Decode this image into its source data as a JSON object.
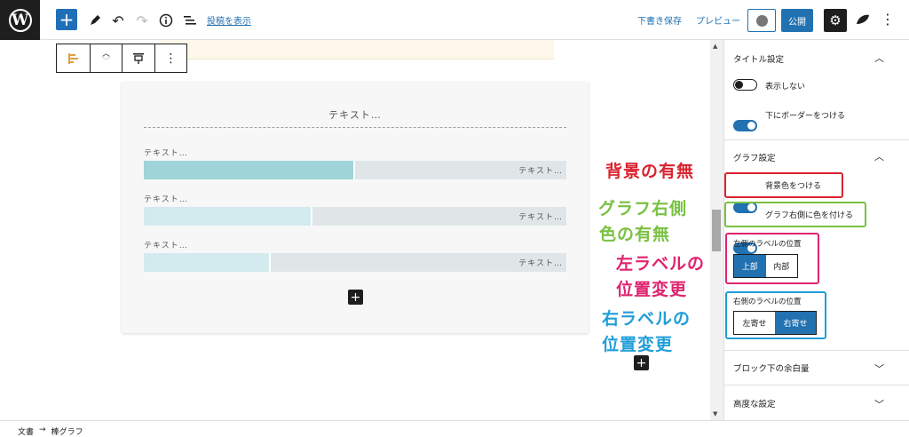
{
  "topbar": {
    "show_post_link": "投稿を表示",
    "save_draft": "下書き保存",
    "preview": "プレビュー",
    "publish": "公開"
  },
  "graph": {
    "title": "テキスト…",
    "rows": [
      {
        "left_label": "テキスト…",
        "right_label": "テキスト…",
        "fill_ratio": 0.5
      },
      {
        "left_label": "テキスト…",
        "right_label": "テキスト…",
        "fill_ratio": 0.4
      },
      {
        "left_label": "テキスト…",
        "right_label": "テキスト…",
        "fill_ratio": 0.3
      }
    ],
    "colors": [
      "#9fd4d9",
      "#d3eaee",
      "#d3eaee"
    ]
  },
  "annotations": {
    "bg": "背景の有無",
    "right_color_line1": "グラフ右側",
    "right_color_line2": "色の有無",
    "left_label_line1": "左ラベルの",
    "left_label_line2": "位置変更",
    "right_label_line1": "右ラベルの",
    "right_label_line2": "位置変更"
  },
  "sidebar": {
    "title_settings": {
      "heading": "タイトル設定",
      "toggles": [
        {
          "label": "表示しない",
          "on": false
        },
        {
          "label": "下にボーダーをつける",
          "on": true
        }
      ]
    },
    "graph_settings": {
      "heading": "グラフ設定",
      "toggles": [
        {
          "label": "背景色をつける",
          "on": true
        },
        {
          "label": "グラフ右側に色を付ける",
          "on": true
        }
      ],
      "left_label_position": {
        "heading": "左側のラベルの位置",
        "options": [
          "上部",
          "内部"
        ],
        "selected": "上部"
      },
      "right_label_position": {
        "heading": "右側のラベルの位置",
        "options": [
          "左寄せ",
          "右寄せ"
        ],
        "selected": "右寄せ"
      }
    },
    "block_margin": "ブロック下の余白量",
    "advanced": "高度な設定"
  },
  "breadcrumb": {
    "doc": "文書",
    "arrow": "→",
    "block": "棒グラフ"
  },
  "theme": {
    "accent": "#2271b1",
    "annot_red": "#d9232f",
    "annot_green": "#7ac143",
    "annot_pink": "#e0236f",
    "annot_blue": "#1f9ed8"
  }
}
